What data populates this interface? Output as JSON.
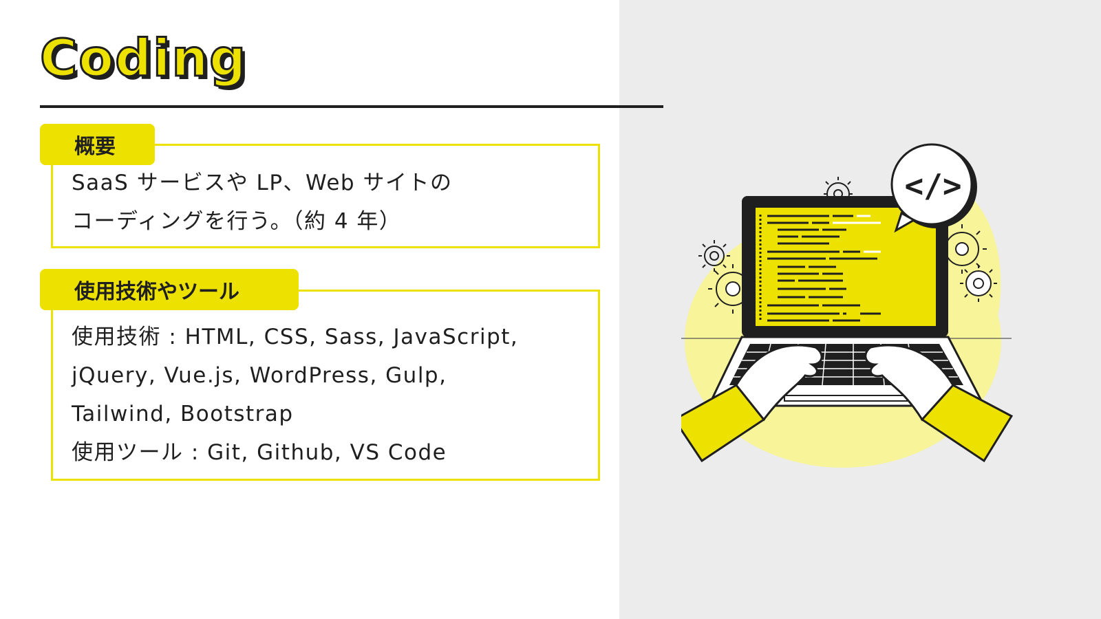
{
  "title": "Coding",
  "overview": {
    "tag": "概要",
    "lines": [
      "SaaS サービスや LP、Web サイトの",
      "コーディングを行う。（約 4 年）"
    ]
  },
  "tech": {
    "tag": "使用技術やツール",
    "lines": [
      "使用技術 : HTML, CSS, Sass, JavaScript,",
      "jQuery, Vue.js, WordPress, Gulp,",
      "Tailwind, Bootstrap",
      "使用ツール : Git, Github, VS Code"
    ]
  },
  "illustration": {
    "code_badge": "</>",
    "icon": "laptop-coding-illustration"
  },
  "colors": {
    "accent": "#ede100",
    "accent_light": "#f7f49a",
    "ink": "#1f1f1f",
    "panel": "#ececec"
  }
}
